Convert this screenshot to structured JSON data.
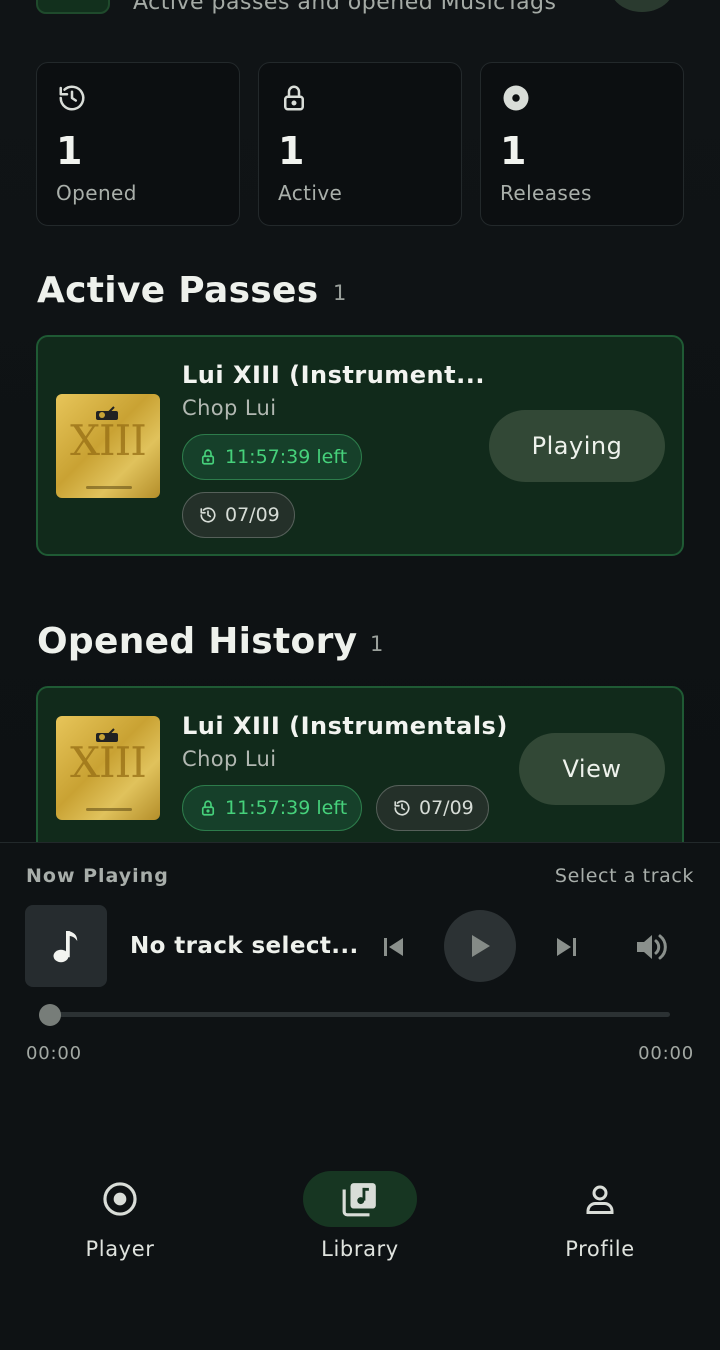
{
  "header": {
    "subtitle": "Active passes and opened MusicTags"
  },
  "stats": [
    {
      "icon": "history-icon",
      "value": "1",
      "label": "Opened"
    },
    {
      "icon": "lock-icon",
      "value": "1",
      "label": "Active"
    },
    {
      "icon": "disc-icon",
      "value": "1",
      "label": "Releases"
    }
  ],
  "active_passes": {
    "title": "Active Passes",
    "count": "1",
    "items": [
      {
        "cover_text": "XIII",
        "title": "Lui XIII (Instrument...",
        "artist": "Chop Lui",
        "time_left": "11:57:39 left",
        "date": "07/09",
        "action": "Playing"
      }
    ]
  },
  "opened_history": {
    "title": "Opened History",
    "count": "1",
    "items": [
      {
        "cover_text": "XIII",
        "title": "Lui XIII (Instrumentals)",
        "artist": "Chop Lui",
        "time_left": "11:57:39 left",
        "date": "07/09",
        "action": "View"
      }
    ]
  },
  "player": {
    "label": "Now Playing",
    "hint": "Select a track",
    "track_title": "No track select...",
    "progress": 0,
    "time_current": "00:00",
    "time_total": "00:00"
  },
  "nav": [
    {
      "icon": "disc-icon",
      "label": "Player",
      "active": false
    },
    {
      "icon": "library-icon",
      "label": "Library",
      "active": true
    },
    {
      "icon": "person-icon",
      "label": "Profile",
      "active": false
    }
  ],
  "colors": {
    "background": "#0f1214",
    "card": "#112a1b",
    "card_border": "#1f5a34",
    "accent_green": "#46d17b",
    "button": "#324836"
  }
}
